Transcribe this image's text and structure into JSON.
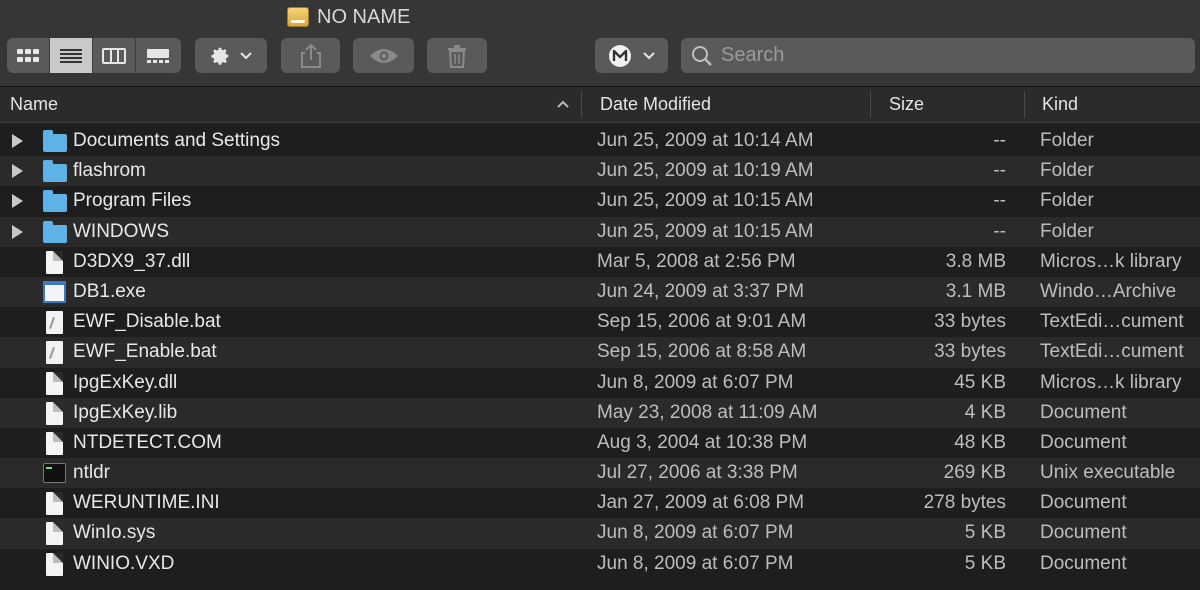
{
  "window": {
    "title": "NO NAME"
  },
  "toolbar": {
    "view_modes": [
      "icon-view",
      "list-view",
      "column-view",
      "gallery-view"
    ],
    "active_view": 1,
    "search_placeholder": "Search"
  },
  "columns": {
    "name": "Name",
    "date": "Date Modified",
    "size": "Size",
    "kind": "Kind"
  },
  "files": [
    {
      "name": "Documents and Settings",
      "date": "Jun 25, 2009 at 10:14 AM",
      "size": "--",
      "kind": "Folder",
      "type": "folder"
    },
    {
      "name": "flashrom",
      "date": "Jun 25, 2009 at 10:19 AM",
      "size": "--",
      "kind": "Folder",
      "type": "folder"
    },
    {
      "name": "Program Files",
      "date": "Jun 25, 2009 at 10:15 AM",
      "size": "--",
      "kind": "Folder",
      "type": "folder"
    },
    {
      "name": "WINDOWS",
      "date": "Jun 25, 2009 at 10:15 AM",
      "size": "--",
      "kind": "Folder",
      "type": "folder"
    },
    {
      "name": "D3DX9_37.dll",
      "date": "Mar 5, 2008 at 2:56 PM",
      "size": "3.8 MB",
      "kind": "Micros…k library",
      "type": "doc"
    },
    {
      "name": "DB1.exe",
      "date": "Jun 24, 2009 at 3:37 PM",
      "size": "3.1 MB",
      "kind": "Windo…Archive",
      "type": "exe"
    },
    {
      "name": "EWF_Disable.bat",
      "date": "Sep 15, 2006 at 9:01 AM",
      "size": "33 bytes",
      "kind": "TextEdi…cument",
      "type": "bat"
    },
    {
      "name": "EWF_Enable.bat",
      "date": "Sep 15, 2006 at 8:58 AM",
      "size": "33 bytes",
      "kind": "TextEdi…cument",
      "type": "bat"
    },
    {
      "name": "IpgExKey.dll",
      "date": "Jun 8, 2009 at 6:07 PM",
      "size": "45 KB",
      "kind": "Micros…k library",
      "type": "doc"
    },
    {
      "name": "IpgExKey.lib",
      "date": "May 23, 2008 at 11:09 AM",
      "size": "4 KB",
      "kind": "Document",
      "type": "doc"
    },
    {
      "name": "NTDETECT.COM",
      "date": "Aug 3, 2004 at 10:38 PM",
      "size": "48 KB",
      "kind": "Document",
      "type": "doc"
    },
    {
      "name": "ntldr",
      "date": "Jul 27, 2006 at 3:38 PM",
      "size": "269 KB",
      "kind": "Unix executable",
      "type": "term"
    },
    {
      "name": "WERUNTIME.INI",
      "date": "Jan 27, 2009 at 6:08 PM",
      "size": "278 bytes",
      "kind": "Document",
      "type": "doc"
    },
    {
      "name": "WinIo.sys",
      "date": "Jun 8, 2009 at 6:07 PM",
      "size": "5 KB",
      "kind": "Document",
      "type": "doc"
    },
    {
      "name": "WINIO.VXD",
      "date": "Jun 8, 2009 at 6:07 PM",
      "size": "5 KB",
      "kind": "Document",
      "type": "doc"
    }
  ]
}
